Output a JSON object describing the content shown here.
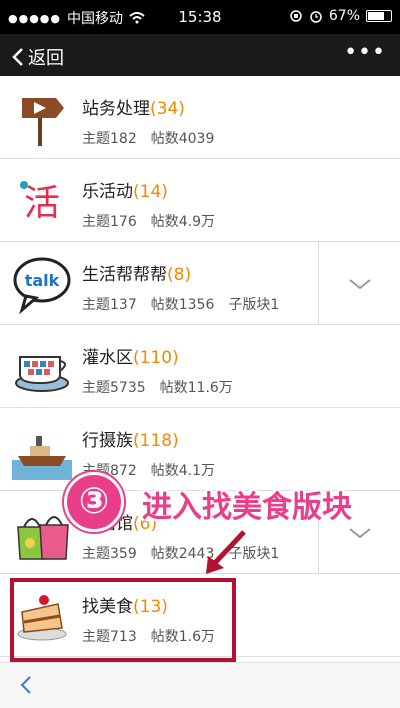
{
  "status": {
    "carrier": "中国移动",
    "time": "15:38",
    "battery": "67%"
  },
  "nav": {
    "back_label": "返回",
    "more_label": "•••"
  },
  "rows": [
    {
      "name": "站务处理",
      "count": "(34)",
      "topics": "主题182",
      "posts": "帖数4039"
    },
    {
      "name": "乐活动",
      "count": "(14)",
      "topics": "主题176",
      "posts": "帖数4.9万"
    },
    {
      "name": "生活帮帮帮",
      "count": "(8)",
      "topics": "主题137",
      "posts": "帖数1356",
      "sub": "子版块1"
    },
    {
      "name": "灌水区",
      "count": "(110)",
      "topics": "主题5735",
      "posts": "帖数11.6万"
    },
    {
      "name": "行摄族",
      "count": "(118)",
      "topics": "主题872",
      "posts": "帖数4.1万"
    },
    {
      "name": "生活馆",
      "count": "(6)",
      "topics": "主题359",
      "posts": "帖数2443",
      "sub": "子版块1"
    },
    {
      "name": "找美食",
      "count": "(13)",
      "topics": "主题713",
      "posts": "帖数1.6万"
    }
  ],
  "overlay": {
    "step": "③",
    "text": "进入找美食版块"
  },
  "icons": {
    "talk": "talk"
  },
  "colors": {
    "accent": "#f08a00",
    "highlight": "#e93f8a",
    "box": "#b2122f"
  }
}
